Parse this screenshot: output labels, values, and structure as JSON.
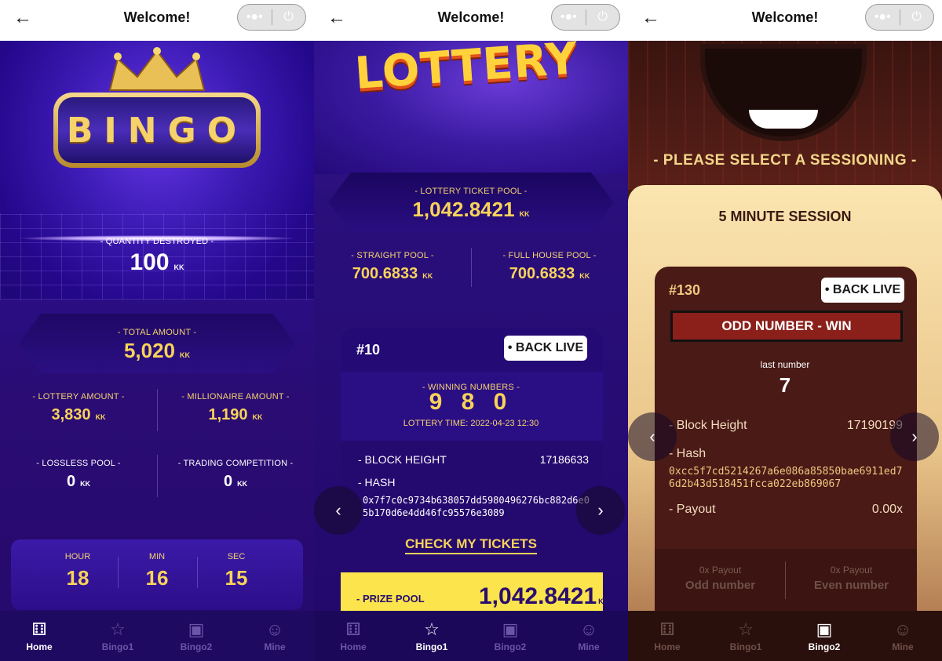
{
  "screens": [
    {
      "header": {
        "title": "Welcome!"
      },
      "bingo_logo": "BINGO",
      "quantity_destroyed": {
        "label": "- QUANTITY DESTROYED -",
        "value": "100",
        "unit": "KK"
      },
      "total_amount": {
        "label": "- TOTAL AMOUNT -",
        "value": "5,020",
        "unit": "KK"
      },
      "lottery_amount": {
        "label": "- LOTTERY AMOUNT -",
        "value": "3,830",
        "unit": "KK"
      },
      "millionaire_amount": {
        "label": "- MILLIONAIRE AMOUNT -",
        "value": "1,190",
        "unit": "KK"
      },
      "lossless_pool": {
        "label": "- LOSSLESS POOL -",
        "value": "0",
        "unit": "KK"
      },
      "trading_competition": {
        "label": "- TRADING COMPETITION -",
        "value": "0",
        "unit": "KK"
      },
      "timer": {
        "hour_label": "HOUR",
        "hour": "18",
        "min_label": "MIN",
        "min": "16",
        "sec_label": "SEC",
        "sec": "15"
      },
      "nav": {
        "home": "Home",
        "bingo1": "Bingo1",
        "bingo2": "Bingo2",
        "mine": "Mine",
        "active": "home"
      }
    },
    {
      "header": {
        "title": "Welcome!"
      },
      "banner_word": "LOTTERY",
      "ticket_pool": {
        "label": "- LOTTERY TICKET POOL -",
        "value": "1,042.8421",
        "unit": "KK"
      },
      "straight_pool": {
        "label": "- STRAIGHT POOL -",
        "value": "700.6833",
        "unit": "KK"
      },
      "full_house_pool": {
        "label": "- FULL HOUSE POOL -",
        "value": "700.6833",
        "unit": "KK"
      },
      "card": {
        "id": "#10",
        "back_live": "• BACK LIVE",
        "winning_label": "- WINNING NUMBERS -",
        "winning_numbers": "9 8 0",
        "lottery_time": "LOTTERY TIME: 2022-04-23 12:30",
        "block_height_label": "- BLOCK HEIGHT",
        "block_height": "17186633",
        "hash_label": "- HASH",
        "hash": "0x7f7c0c9734b638057dd5980496276bc882d6e05b170d6e4dd46fc95576e3089",
        "check_tickets": "CHECK MY TICKETS",
        "prize_label": "- PRIZE POOL",
        "prize_value": "1,042.8421",
        "prize_unit": "KK"
      },
      "nav": {
        "home": "Home",
        "bingo1": "Bingo1",
        "bingo2": "Bingo2",
        "mine": "Mine",
        "active": "bingo1"
      }
    },
    {
      "header": {
        "title": "Welcome!"
      },
      "select_session": "- PLEASE SELECT A SESSIONING -",
      "session_title": "5 MINUTE SESSION",
      "card": {
        "id": "#130",
        "back_live": "• BACK LIVE",
        "result": "ODD NUMBER - WIN",
        "last_number_label": "last number",
        "last_number": "7",
        "block_height_label": "- Block Height",
        "block_height": "17190199",
        "hash_label": "- Hash",
        "hash": "0xcc5f7cd5214267a6e086a85850bae6911ed76d2b43d518451fcca022eb869067",
        "payout_label": "- Payout",
        "payout": "0.00x",
        "odd_payout_label": "0x Payout",
        "odd_label": "Odd number",
        "even_payout_label": "0x Payout",
        "even_label": "Even number"
      },
      "nav": {
        "home": "Home",
        "bingo1": "Bingo1",
        "bingo2": "Bingo2",
        "mine": "Mine",
        "active": "bingo2"
      }
    }
  ],
  "colors": {
    "gold": "#f8d35a",
    "purple_bg": "#2a0e87",
    "maroon_bg": "#4a1a16",
    "result_red": "#8b1f1a",
    "prize_yellow": "#fbe44c"
  }
}
